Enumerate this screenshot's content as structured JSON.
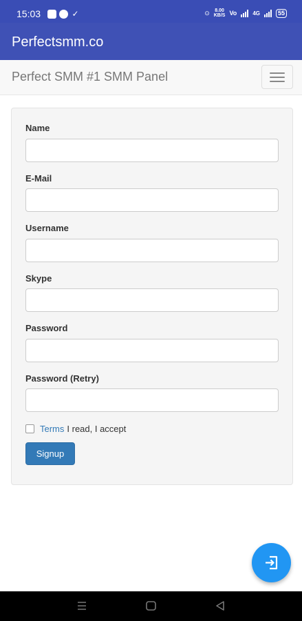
{
  "status_bar": {
    "time": "15:03",
    "net_speed_top": "8.00",
    "net_speed_bottom": "KB/S",
    "volte": "Vo",
    "network": "4G",
    "battery": "55"
  },
  "app_bar": {
    "title": "Perfectsmm.co"
  },
  "navbar": {
    "brand": "Perfect SMM #1 SMM Panel"
  },
  "form": {
    "fields": [
      {
        "label": "Name",
        "value": "",
        "placeholder": ""
      },
      {
        "label": "E-Mail",
        "value": "",
        "placeholder": ""
      },
      {
        "label": "Username",
        "value": "",
        "placeholder": ""
      },
      {
        "label": "Skype",
        "value": "",
        "placeholder": ""
      },
      {
        "label": "Password",
        "value": "",
        "placeholder": ""
      },
      {
        "label": "Password (Retry)",
        "value": "",
        "placeholder": ""
      }
    ],
    "terms_link": "Terms",
    "terms_text": "I read, I accept",
    "terms_checked": false,
    "signup_label": "Signup"
  },
  "colors": {
    "status_bar": "#3a4db5",
    "app_bar": "#3f51b5",
    "link": "#337ab7",
    "button": "#337ab7",
    "fab": "#2196f3"
  },
  "icons": {
    "fab": "login-icon",
    "nav_menu": "recent-apps-icon",
    "nav_home": "home-icon",
    "nav_back": "back-icon"
  }
}
